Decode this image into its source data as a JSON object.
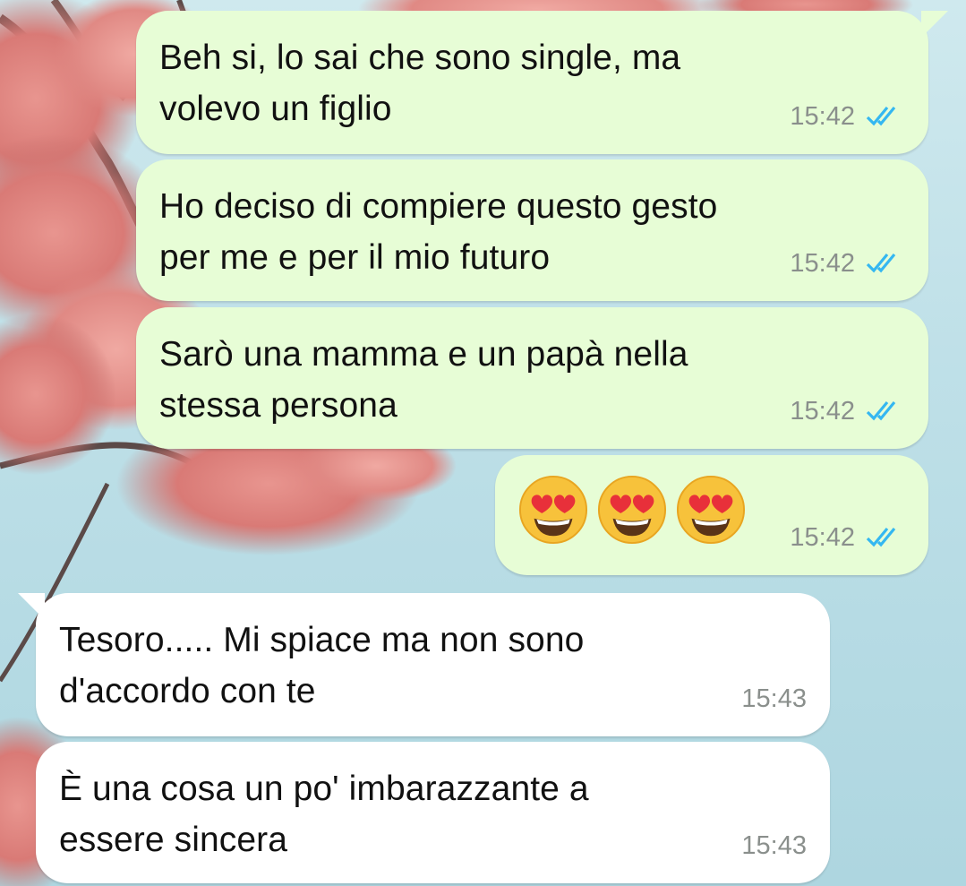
{
  "chat": {
    "messages": [
      {
        "direction": "outgoing",
        "text": "Beh si, lo sai che sono single, ma\nvolevo un figlio",
        "time": "15:42",
        "status": "read"
      },
      {
        "direction": "outgoing",
        "text": "Ho deciso di compiere questo gesto\nper me e per il mio futuro",
        "time": "15:42",
        "status": "read"
      },
      {
        "direction": "outgoing",
        "text": "Sarò una mamma e un papà nella\nstessa persona",
        "time": "15:42",
        "status": "read"
      },
      {
        "direction": "outgoing",
        "emoji": [
          "smiling-face-with-heart-eyes",
          "smiling-face-with-heart-eyes",
          "smiling-face-with-heart-eyes"
        ],
        "time": "15:42",
        "status": "read"
      },
      {
        "direction": "incoming",
        "text": "Tesoro..... Mi spiace ma non sono\nd'accordo con te",
        "time": "15:43"
      },
      {
        "direction": "incoming",
        "text": "È una cosa un po' imbarazzante a\nessere sincera",
        "time": "15:43"
      }
    ]
  },
  "colors": {
    "outgoing_bubble": "#e7fdd6",
    "incoming_bubble": "#ffffff",
    "read_ticks": "#34b7f1",
    "timestamp": "#8a8f8c"
  },
  "icons": {
    "read_status": "double-check-icon",
    "emoji": "heart-eyes-emoji-icon"
  }
}
